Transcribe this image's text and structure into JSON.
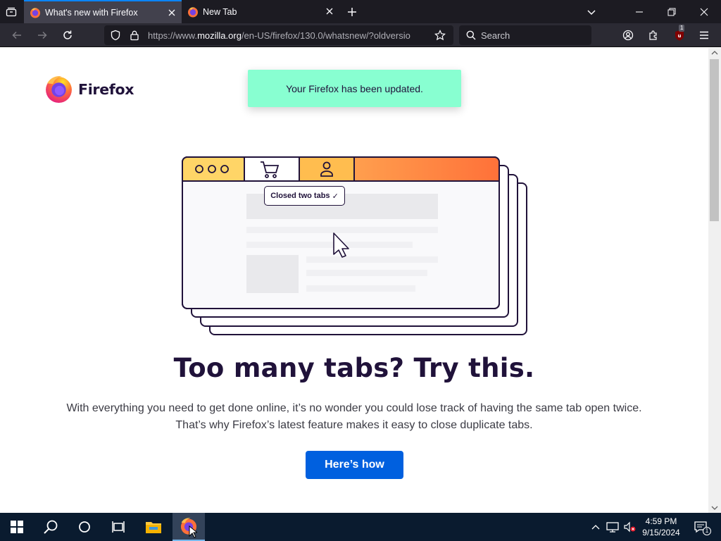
{
  "browser": {
    "tabs": [
      {
        "title": "What's new with Firefox",
        "active": true
      },
      {
        "title": "New Tab",
        "active": false
      }
    ],
    "url": {
      "prefix": "https://www.",
      "domain": "mozilla.org",
      "path": "/en-US/firefox/130.0/whatsnew/?oldversio"
    },
    "search_placeholder": "Search",
    "extension_badge": "1",
    "accent_color": "#0a84ff"
  },
  "page": {
    "brand": "Firefox",
    "notification": "Your Firefox has been updated.",
    "illustration": {
      "badge_text": "Closed two tabs",
      "badge_check": "✓"
    },
    "headline": "Too many tabs? Try this.",
    "body_line1": "With everything you need to get done online, it’s no wonder you could lose track of having the same tab open twice.",
    "body_line2": "That’s why Firefox’s latest feature makes it easy to close duplicate tabs.",
    "cta": "Here’s how",
    "cta_color": "#0060df",
    "toast_color": "#88ffd1"
  },
  "taskbar": {
    "time": "4:59 PM",
    "date": "9/15/2024",
    "notification_count": "1"
  }
}
